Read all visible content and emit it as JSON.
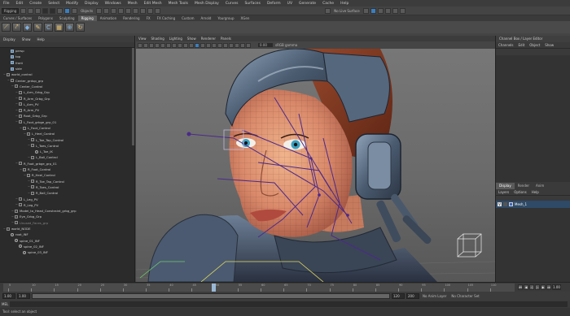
{
  "menubar": {
    "items": [
      "File",
      "Edit",
      "Create",
      "Select",
      "Modify",
      "Display",
      "Windows",
      "Mesh",
      "Edit Mesh",
      "Mesh Tools",
      "Mesh Display",
      "Curves",
      "Surfaces",
      "Deform",
      "UV",
      "Generate",
      "Cache",
      "Help"
    ]
  },
  "statusline": {
    "menuset": "Rigging",
    "objects_label": "Objects",
    "live_surface": "No Live Surface"
  },
  "shelf_tabs": {
    "items": [
      "Curves / Surfaces",
      "Polygons",
      "Sculpting",
      "Rigging",
      "Animation",
      "Rendering",
      "FX",
      "FX Caching",
      "Custom",
      "Arnold",
      "Yourgroup",
      "XGen"
    ],
    "active_index": 3
  },
  "outliner": {
    "menu": [
      "Display",
      "Show",
      "Help"
    ],
    "rows": [
      {
        "label": "persp",
        "depth": 1,
        "icon": "cam"
      },
      {
        "label": "top",
        "depth": 1,
        "icon": "cam"
      },
      {
        "label": "front",
        "depth": 1,
        "icon": "cam"
      },
      {
        "label": "side",
        "depth": 1,
        "icon": "cam"
      },
      {
        "label": "world_control",
        "depth": 0,
        "icon": "grp"
      },
      {
        "label": "Center_grdup_grp",
        "depth": 1,
        "icon": "grp"
      },
      {
        "label": "Center_Control",
        "depth": 2,
        "icon": "ctl"
      },
      {
        "label": "L_Arm_Grbg_Grp",
        "depth": 3,
        "icon": "grp"
      },
      {
        "label": "R_Arm_Grbg_Grp",
        "depth": 3,
        "icon": "grp"
      },
      {
        "label": "L_Arm_PV",
        "depth": 3,
        "icon": "ctl"
      },
      {
        "label": "R_Arm_PV",
        "depth": 3,
        "icon": "ctl"
      },
      {
        "label": "Root_Grbg_Grp",
        "depth": 3,
        "icon": "grp"
      },
      {
        "label": "L_Foot_grbge_grp_01",
        "depth": 3,
        "icon": "grp"
      },
      {
        "label": "L_Foot_Control",
        "depth": 4,
        "icon": "ctl"
      },
      {
        "label": "L_Heel_Control",
        "depth": 5,
        "icon": "ctl"
      },
      {
        "label": "L_Toe_Tap_Control",
        "depth": 6,
        "icon": "ctl"
      },
      {
        "label": "L_Toes_Control",
        "depth": 6,
        "icon": "ctl"
      },
      {
        "label": "L_Toe_IK",
        "depth": 7,
        "icon": "jnt"
      },
      {
        "label": "L_Ball_Control",
        "depth": 6,
        "icon": "ctl"
      },
      {
        "label": "R_Foot_grbge_grp_01",
        "depth": 3,
        "icon": "grp"
      },
      {
        "label": "R_Foot_Control",
        "depth": 4,
        "icon": "ctl"
      },
      {
        "label": "R_Heel_Control",
        "depth": 5,
        "icon": "ctl"
      },
      {
        "label": "R_Toe_Tap_Control",
        "depth": 6,
        "icon": "ctl"
      },
      {
        "label": "R_Toes_Control",
        "depth": 6,
        "icon": "ctl"
      },
      {
        "label": "R_Ball_Control",
        "depth": 6,
        "icon": "ctl"
      },
      {
        "label": "L_Leg_PV",
        "depth": 3,
        "icon": "ctl"
      },
      {
        "label": "R_Leg_PV",
        "depth": 3,
        "icon": "ctl"
      },
      {
        "label": "Model_to_Head_Constraint_grbg_grp",
        "depth": 2,
        "icon": "grp"
      },
      {
        "label": "Eye_Grbg_Grp",
        "depth": 2,
        "icon": "grp"
      },
      {
        "label": "Unused_Faces_grp",
        "depth": 2,
        "icon": "grp",
        "dim": true
      },
      {
        "label": "world_NODE",
        "depth": 0,
        "icon": "grp"
      },
      {
        "label": "root_INF",
        "depth": 1,
        "icon": "jnt"
      },
      {
        "label": "spine_01_INF",
        "depth": 2,
        "icon": "jnt"
      },
      {
        "label": "spine_02_INF",
        "depth": 3,
        "icon": "jnt"
      },
      {
        "label": "spine_03_INF",
        "depth": 4,
        "icon": "jnt"
      }
    ]
  },
  "viewport": {
    "menu": [
      "View",
      "Shading",
      "Lighting",
      "Show",
      "Renderer",
      "Panels"
    ],
    "readout": "0.00",
    "gamma": "sRGB gamma"
  },
  "channelbox": {
    "title": "Channel Box / Layer Editor",
    "menu": [
      "Channels",
      "Edit",
      "Object",
      "Show"
    ]
  },
  "layer_editor": {
    "tabs": [
      "Display",
      "Render",
      "Anim"
    ],
    "active_tab": 0,
    "menu": [
      "Layers",
      "Options",
      "Help"
    ],
    "layer_name": "Mesh_1",
    "visible_mark": "V",
    "layer_color": "#3b66c4"
  },
  "timeslider": {
    "tick_labels": [
      "5",
      "10",
      "15",
      "20",
      "25",
      "30",
      "35",
      "40",
      "45",
      "50",
      "55",
      "60",
      "65",
      "70",
      "75",
      "80",
      "85",
      "90",
      "95",
      "100",
      "105",
      "110"
    ],
    "current_frame": "1.00"
  },
  "rangeslider": {
    "start": "1.00",
    "anim_start": "1.00",
    "anim_end": "120",
    "end": "200",
    "anim_layer": "No Anim Layer",
    "char_set": "No Character Set"
  },
  "cmdline": {
    "label": "MEL"
  },
  "helpline": {
    "text": "Tool: select an object"
  },
  "colors": {
    "selection": "#4a6c8f",
    "accent": "#3a7fbf",
    "rig_lines": "#4b2a8a",
    "ui_bg": "#444444"
  }
}
